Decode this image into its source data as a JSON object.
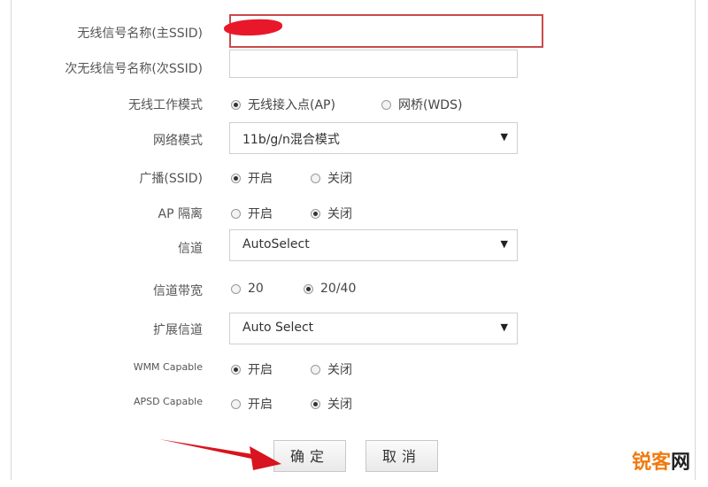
{
  "form": {
    "ssid_primary": {
      "label": "无线信号名称(主SSID)",
      "value": ""
    },
    "ssid_secondary": {
      "label": "次无线信号名称(次SSID)",
      "value": ""
    },
    "work_mode": {
      "label": "无线工作模式",
      "opt1": "无线接入点(AP)",
      "opt2": "网桥(WDS)",
      "selected": 1
    },
    "net_mode": {
      "label": "网络模式",
      "value": "11b/g/n混合模式"
    },
    "broadcast": {
      "label": "广播(SSID)",
      "opt1": "开启",
      "opt2": "关闭",
      "selected": 1
    },
    "ap_isolation": {
      "label": "AP 隔离",
      "opt1": "开启",
      "opt2": "关闭",
      "selected": 2
    },
    "channel": {
      "label": "信道",
      "value": "AutoSelect"
    },
    "bandwidth": {
      "label": "信道带宽",
      "opt1": "20",
      "opt2": "20/40",
      "selected": 2
    },
    "ext_channel": {
      "label": "扩展信道",
      "value": "Auto Select"
    },
    "wmm": {
      "label": "WMM Capable",
      "opt1": "开启",
      "opt2": "关闭",
      "selected": 1
    },
    "apsd": {
      "label": "APSD Capable",
      "opt1": "开启",
      "opt2": "关闭",
      "selected": 2
    }
  },
  "buttons": {
    "ok": "确定",
    "cancel": "取消"
  },
  "watermark": {
    "brand_a": "锐客",
    "brand_b": "网"
  },
  "colors": {
    "annotation_red": "#e8182a",
    "watermark_orange": "#f07a10"
  }
}
